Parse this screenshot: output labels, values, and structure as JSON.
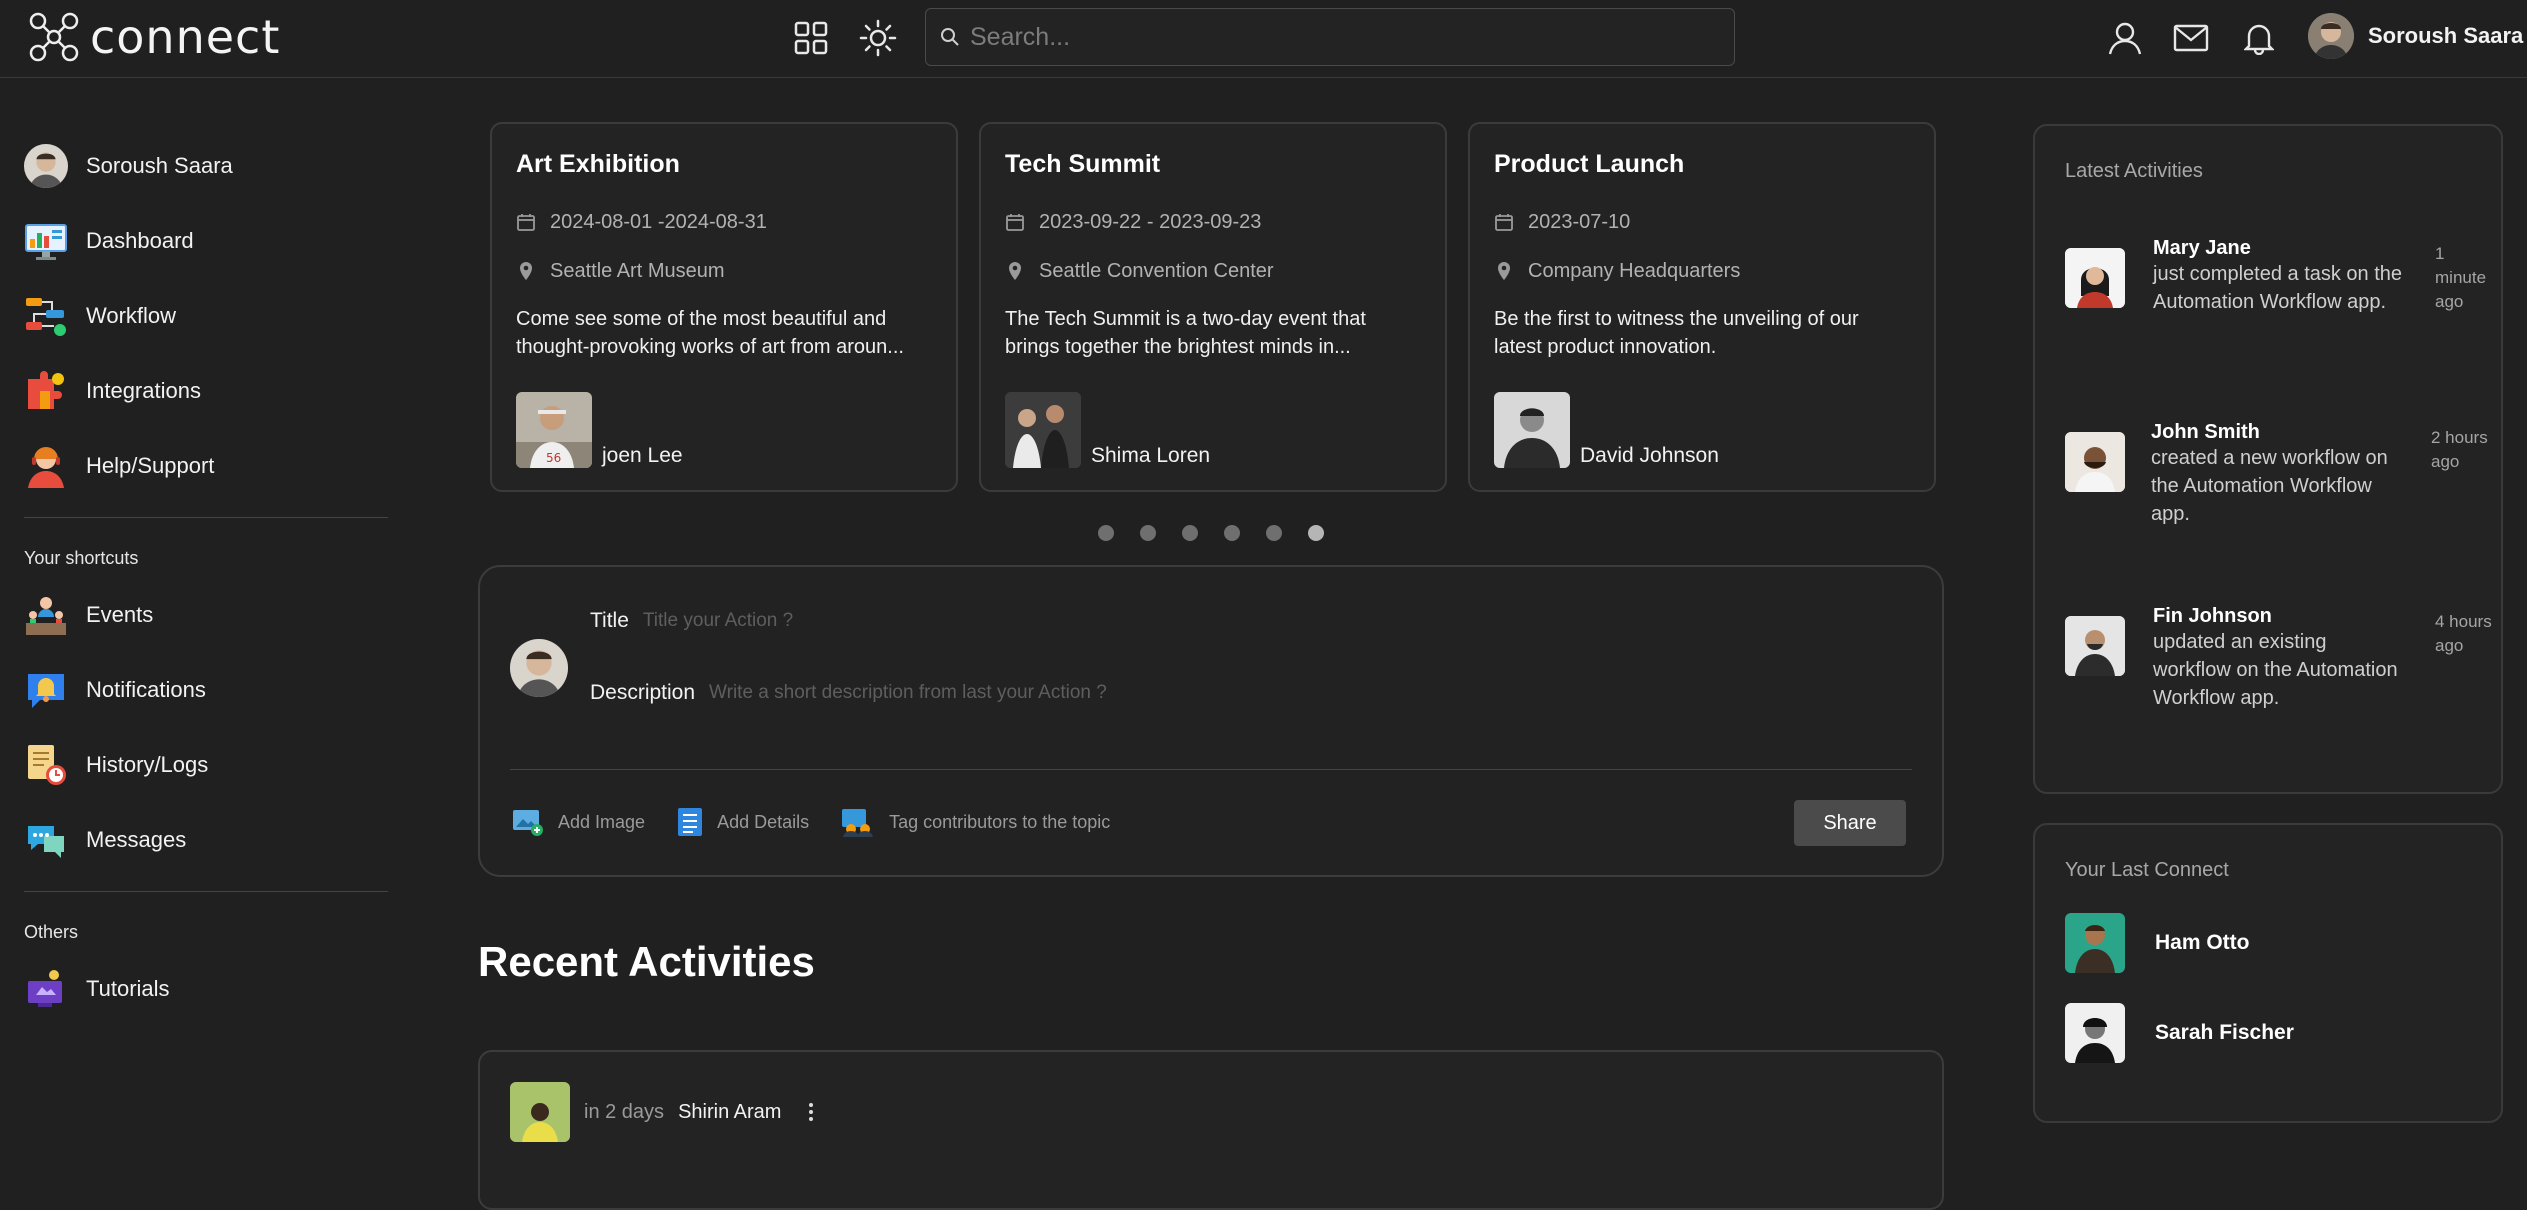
{
  "app": {
    "logo_text": "connect"
  },
  "header": {
    "search_placeholder": "Search...",
    "user_name": "Soroush Saara",
    "icons": [
      "apps-grid-icon",
      "theme-sun-icon",
      "search-icon",
      "profile-icon",
      "mail-icon",
      "bell-icon"
    ]
  },
  "sidebar": {
    "profile_name": "Soroush Saara",
    "main_items": [
      {
        "label": "Dashboard",
        "icon": "dashboard-icon"
      },
      {
        "label": "Workflow",
        "icon": "workflow-icon"
      },
      {
        "label": "Integrations",
        "icon": "integrations-icon"
      },
      {
        "label": "Help/Support",
        "icon": "support-icon"
      }
    ],
    "shortcuts_heading": "Your shortcuts",
    "shortcut_items": [
      {
        "label": "Events",
        "icon": "events-icon"
      },
      {
        "label": "Notifications",
        "icon": "notifications-icon"
      },
      {
        "label": "History/Logs",
        "icon": "history-icon"
      },
      {
        "label": "Messages",
        "icon": "messages-icon"
      }
    ],
    "others_heading": "Others",
    "other_items": [
      {
        "label": "Tutorials",
        "icon": "tutorials-icon"
      }
    ]
  },
  "events": [
    {
      "title": "Art Exhibition",
      "date": "2024-08-01 -2024-08-31",
      "location": "Seattle Art Museum",
      "description": "Come see some of the most beautiful and thought-provoking works of art from aroun...",
      "host": "joen Lee"
    },
    {
      "title": "Tech Summit",
      "date": "2023-09-22 - 2023-09-23",
      "location": "Seattle Convention Center",
      "description": "The Tech Summit is a two-day event that brings together the brightest minds in...",
      "host": "Shima Loren"
    },
    {
      "title": "Product Launch",
      "date": "2023-07-10",
      "location": "Company Headquarters",
      "description": "Be the first to witness the unveiling of our latest product innovation.",
      "host": "David Johnson"
    }
  ],
  "carousel": {
    "page_count": 6,
    "active_index": 5
  },
  "composer": {
    "title_label": "Title",
    "title_placeholder": "Title your Action ?",
    "description_label": "Description",
    "description_placeholder": "Write a short description from last your Action ?",
    "add_image": "Add Image",
    "add_details": "Add Details",
    "tag_contributors": "Tag contributors to the topic",
    "share": "Share"
  },
  "recent": {
    "heading": "Recent Activities",
    "items": [
      {
        "when": "in 2 days",
        "name": "Shirin Aram"
      }
    ]
  },
  "latest_activities": {
    "heading": "Latest Activities",
    "items": [
      {
        "name": "Mary Jane",
        "text": "just completed a task on the Automation Workflow app.",
        "time": "1 minute ago"
      },
      {
        "name": "John Smith",
        "text": "created a new workflow on the Automation Workflow app.",
        "time": "2 hours ago"
      },
      {
        "name": "Fin Johnson",
        "text": "updated an existing workflow on the Automation Workflow app.",
        "time": "4 hours ago"
      }
    ]
  },
  "last_connect": {
    "heading": "Your Last Connect",
    "items": [
      {
        "name": "Ham Otto"
      },
      {
        "name": "Sarah Fischer"
      }
    ]
  }
}
